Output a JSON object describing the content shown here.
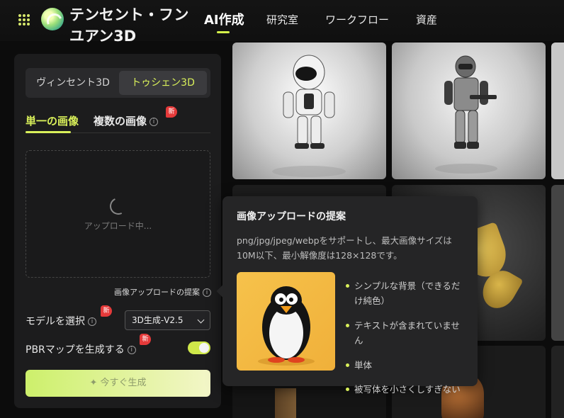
{
  "header": {
    "brand": "テンセント・フンユアン3D",
    "nav": [
      "AI作成",
      "研究室",
      "ワークフロー",
      "資産"
    ],
    "active_nav": "AI作成"
  },
  "panel": {
    "segments": [
      "ヴィンセント3D",
      "トゥシェン3D"
    ],
    "active_segment": "トゥシェン3D",
    "tabs": {
      "single": "単一の画像",
      "multi": "複数の画像",
      "multi_badge": "新"
    },
    "upload": {
      "status": "アップロード中..."
    },
    "hint_link": "画像アップロードの提案",
    "model": {
      "label": "モデルを選択",
      "badge": "新",
      "selected": "3D生成-V2.5"
    },
    "pbr": {
      "label": "PBRマップを生成する",
      "badge": "新",
      "enabled": true
    },
    "generate_button": "✦ 今すぐ生成"
  },
  "popup": {
    "title": "画像アップロードの提案",
    "description": "png/jpg/jpeg/webpをサポートし、最大画像サイズは10M以下、最小解像度は128×128です。",
    "requirements": [
      "シンプルな背景（できるだけ純色）",
      "テキストが含まれていません",
      "単体",
      "被写体を小さくしすぎない"
    ]
  },
  "colors": {
    "accent": "#d9f05a",
    "badge": "#e53a3a",
    "panel": "#1c1c1d",
    "popup": "#252526"
  }
}
